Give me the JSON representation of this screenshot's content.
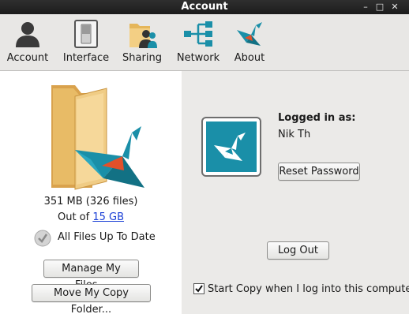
{
  "window": {
    "title": "Account",
    "minimize_glyph": "–",
    "maximize_glyph": "□",
    "close_glyph": "✕"
  },
  "toolbar": {
    "items": [
      {
        "label": "Account",
        "icon": "person-icon"
      },
      {
        "label": "Interface",
        "icon": "switch-icon"
      },
      {
        "label": "Sharing",
        "icon": "shared-folder-icon"
      },
      {
        "label": "Network",
        "icon": "network-icon"
      },
      {
        "label": "About",
        "icon": "copy-bird-logo-icon"
      }
    ]
  },
  "storage": {
    "usage_text": "351 MB (326 files)",
    "out_of_prefix": "Out of ",
    "quota": "15 GB",
    "status_text": "All Files Up To Date",
    "manage_button": "Manage My Files...",
    "move_button": "Move My Copy Folder..."
  },
  "account": {
    "logged_in_label": "Logged in as:",
    "user_name": "Nik Th",
    "reset_password_button": "Reset Password",
    "logout_button": "Log Out",
    "startup_checkbox_label": "Start Copy when I log into this computer",
    "startup_checked": true
  },
  "colors": {
    "accent": "#1a8fa8",
    "link": "#1a3fd6",
    "titlebar": "#262626"
  }
}
